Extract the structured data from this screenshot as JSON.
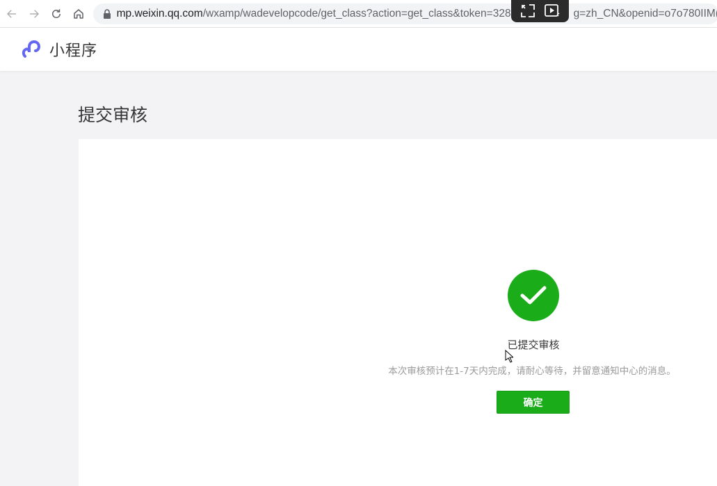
{
  "browser": {
    "url_host": "mp.weixin.qq.com",
    "url_path_before": "/wxamp/wadevelopcode/get_class?action=get_class&token=328",
    "url_path_after": "g=zh_CN&openid=o7o780IIM("
  },
  "header": {
    "app_name": "小程序"
  },
  "page": {
    "title": "提交审核"
  },
  "result": {
    "title": "已提交审核",
    "description": "本次审核预计在1-7天内完成，请耐心等待，并留意通知中心的消息。",
    "confirm_label": "确定"
  },
  "colors": {
    "success_green": "#1aad19",
    "brand_purple": "#6467f0"
  },
  "icons": {
    "back": "arrow-left-icon",
    "forward": "arrow-right-icon",
    "reload": "reload-icon",
    "home": "home-icon",
    "lock": "lock-icon",
    "success": "check-circle-icon"
  }
}
